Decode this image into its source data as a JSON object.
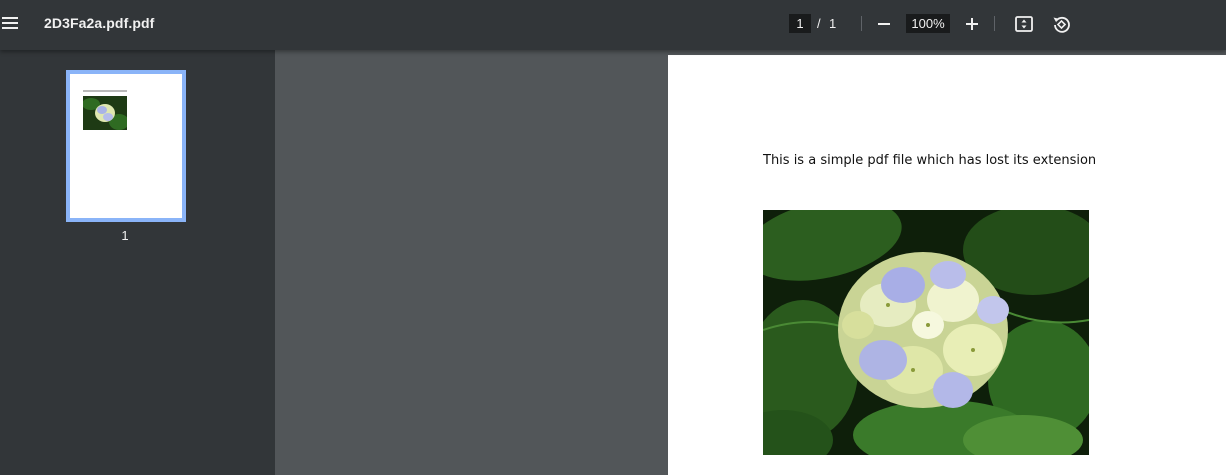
{
  "toolbar": {
    "title": "2D3Fa2a.pdf.pdf",
    "menu_icon": "menu-icon",
    "page_current": "1",
    "page_separator": "/",
    "page_total": "1",
    "zoom_value": "100%",
    "zoom_out_icon": "minus-icon",
    "zoom_in_icon": "plus-icon",
    "fit_icon": "fit-to-page-icon",
    "rotate_icon": "rotate-icon"
  },
  "sidebar": {
    "thumbnails": [
      {
        "page_number": "1",
        "selected": true
      }
    ]
  },
  "document": {
    "pages": [
      {
        "text": "This is a simple pdf file which has lost its extension",
        "image": "hydrangea-flower-photo"
      }
    ]
  },
  "colors": {
    "toolbar_bg": "#323639",
    "viewer_bg": "#525659",
    "thumbnail_border": "#8ab4f8",
    "text": "#f1f1f1"
  }
}
